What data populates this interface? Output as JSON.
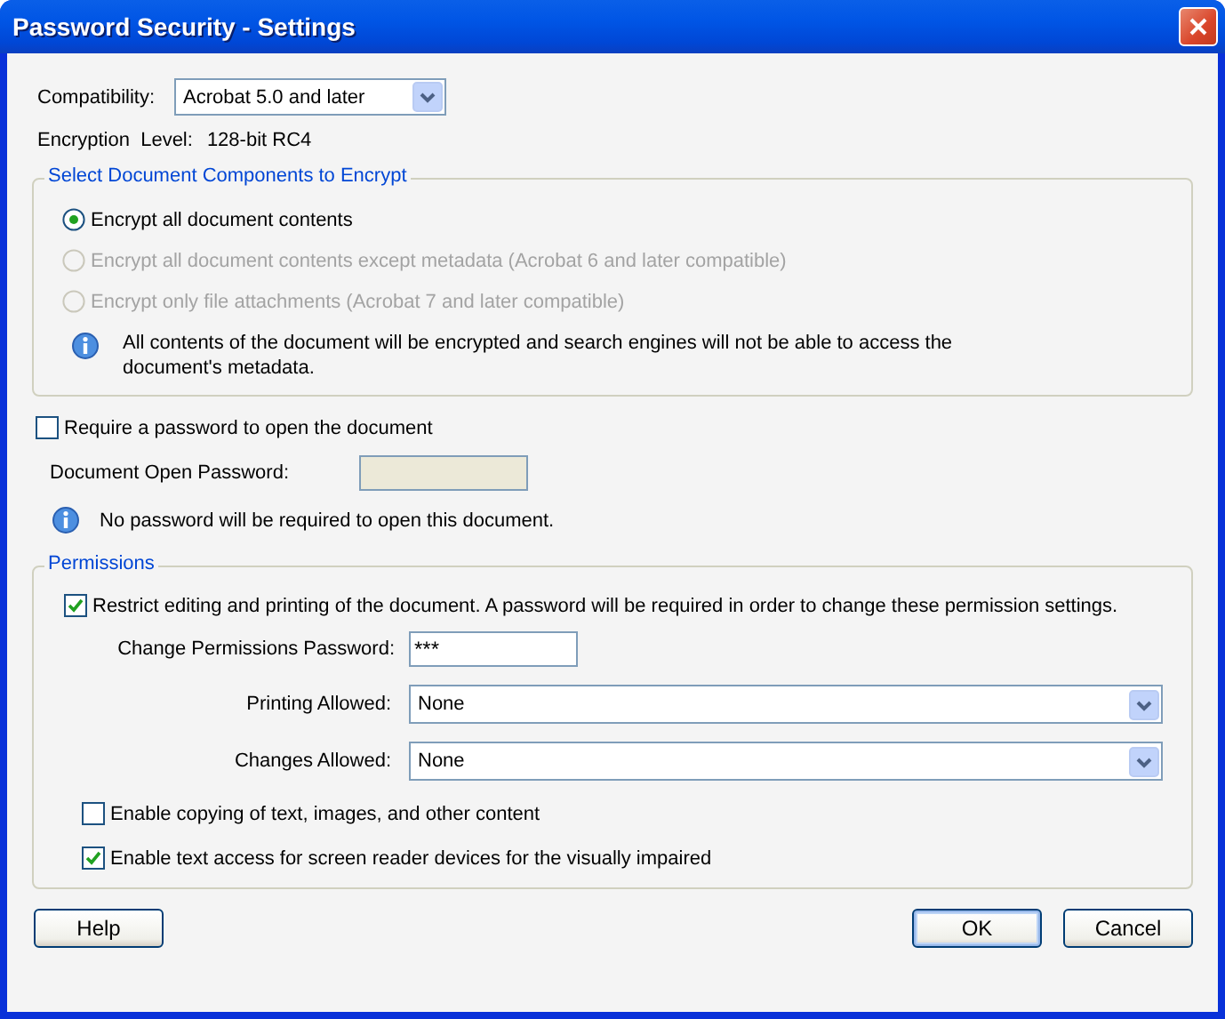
{
  "window": {
    "title": "Password Security - Settings"
  },
  "compatibility": {
    "label": "Compatibility:",
    "value": "Acrobat 5.0 and later"
  },
  "encryption_level": {
    "label": "Encryption  Level:",
    "value": "128-bit RC4"
  },
  "encrypt_group": {
    "title": "Select Document Components to Encrypt",
    "options": [
      {
        "label": "Encrypt all document contents",
        "selected": true,
        "disabled": false
      },
      {
        "label": "Encrypt all document contents except metadata (Acrobat 6 and later compatible)",
        "selected": false,
        "disabled": true
      },
      {
        "label": "Encrypt only file attachments (Acrobat 7 and later compatible)",
        "selected": false,
        "disabled": true
      }
    ],
    "info": "All contents of the document will be encrypted and search engines will not be able to access the document's metadata."
  },
  "open_password": {
    "label": "Require a password to open the document",
    "checked": false,
    "field_label": "Document Open Password:",
    "field_disabled": true,
    "info": "No password will be required to open this document."
  },
  "permissions": {
    "title": "Permissions",
    "restrict": {
      "label": "Restrict editing and printing of the document. A password will be required in order to change these permission settings.",
      "checked": true
    },
    "password": {
      "label": "Change Permissions Password:",
      "value": "***"
    },
    "selects": [
      {
        "label": "Printing Allowed:",
        "value": "None"
      },
      {
        "label": "Changes Allowed:",
        "value": "None"
      }
    ],
    "options": [
      {
        "label": "Enable copying of text, images, and other content",
        "checked": false
      },
      {
        "label": "Enable text access for screen reader devices for the visually impaired",
        "checked": true
      }
    ]
  },
  "buttons": [
    {
      "label": "Help",
      "kind": "left",
      "default": false
    },
    {
      "label": "OK",
      "kind": "right",
      "default": true
    },
    {
      "label": "Cancel",
      "kind": "right",
      "default": false
    }
  ]
}
